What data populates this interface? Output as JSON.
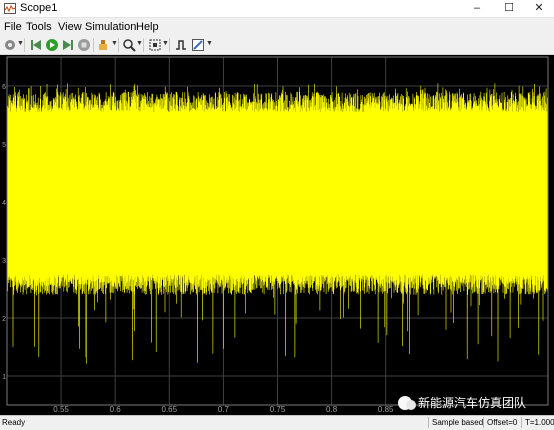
{
  "window": {
    "title": "Scope1",
    "controls": {
      "minimize": "–",
      "maximize": "☐",
      "close": "✕"
    }
  },
  "menu": [
    "File",
    "Tools",
    "View",
    "Simulation",
    "Help"
  ],
  "toolbar": {
    "icons": [
      "settings-icon",
      "step-back-icon",
      "run-icon",
      "step-forward-icon",
      "stop-icon",
      "highlight-icon",
      "zoom-icon",
      "autoscale-icon",
      "triggers-icon",
      "style-icon"
    ]
  },
  "chart_data": {
    "type": "line",
    "xlim": [
      0.5,
      1.0
    ],
    "ylim": [
      0.5,
      6.5
    ],
    "xticks": [
      "0.55",
      "0.6",
      "0.65",
      "0.7",
      "0.75",
      "0.8",
      "0.85"
    ],
    "yticks": [
      "1",
      "2",
      "3",
      "4",
      "5",
      "6"
    ],
    "grid": true,
    "colors": {
      "background": "#000000",
      "trace": "#ffff00",
      "grid": "#404040",
      "axis_text": "#a0a0a0"
    },
    "series": [
      {
        "description_values": {
          "typical_min": 2.4,
          "typical_max": 5.9,
          "spike_min": 1.2,
          "spike_max": 6.05
        }
      }
    ]
  },
  "watermark": "新能源汽车仿真团队",
  "status": {
    "ready": "Ready",
    "mode": "Sample based",
    "offset": "Offset=0",
    "time": "T=1.000"
  }
}
